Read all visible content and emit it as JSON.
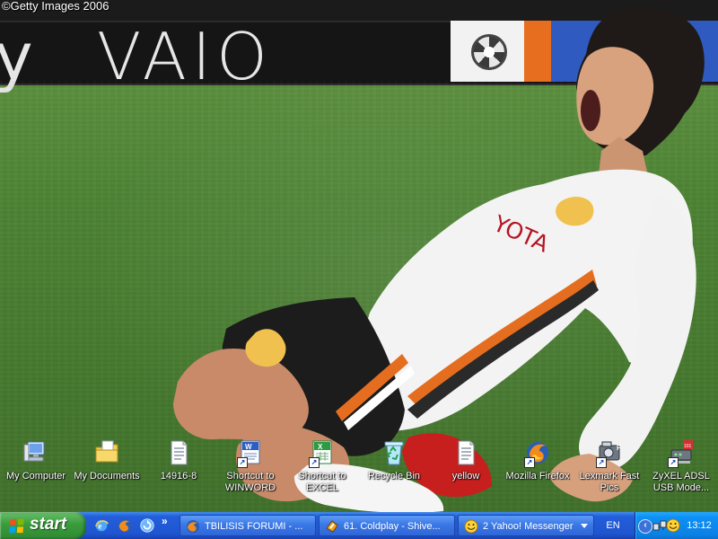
{
  "wallpaper": {
    "watermark": "©Getty Images 2006",
    "banner_text": "VAIO"
  },
  "desktop_icons": [
    {
      "label": "My Computer",
      "icon": "my-computer-icon"
    },
    {
      "label": "My Documents",
      "icon": "my-documents-icon"
    },
    {
      "label": "14916-8",
      "icon": "text-document-icon"
    },
    {
      "label": "Shortcut to WINWORD",
      "icon": "word-icon"
    },
    {
      "label": "Shortcut to EXCEL",
      "icon": "excel-icon"
    },
    {
      "label": "Recycle Bin",
      "icon": "recycle-bin-icon"
    },
    {
      "label": "yellow",
      "icon": "text-document-icon"
    },
    {
      "label": "Mozilla Firefox",
      "icon": "firefox-icon"
    },
    {
      "label": "Lexmark Fast Pics",
      "icon": "lexmark-icon"
    },
    {
      "label": "ZyXEL ADSL USB Mode...",
      "icon": "network-icon"
    }
  ],
  "taskbar": {
    "start_label": "start",
    "quick_launch": [
      "internet-explorer-icon",
      "firefox-icon",
      "refresh-icon"
    ],
    "quick_launch_more": "»",
    "tasks": [
      {
        "label": "TBILISIS FORUMI - ...",
        "icon": "firefox-icon"
      },
      {
        "label": "61. Coldplay - Shive...",
        "icon": "winamp-icon"
      },
      {
        "label": "2 Yahoo! Messenger",
        "icon": "yahoo-messenger-icon"
      }
    ],
    "language": "EN",
    "clock": "13:12",
    "tray_icons": [
      "network-icon",
      "yahoo-messenger-icon"
    ]
  },
  "colors": {
    "taskbar_blue": "#245edb",
    "start_green": "#3a9b3c",
    "tray_blue": "#0d90f4"
  }
}
